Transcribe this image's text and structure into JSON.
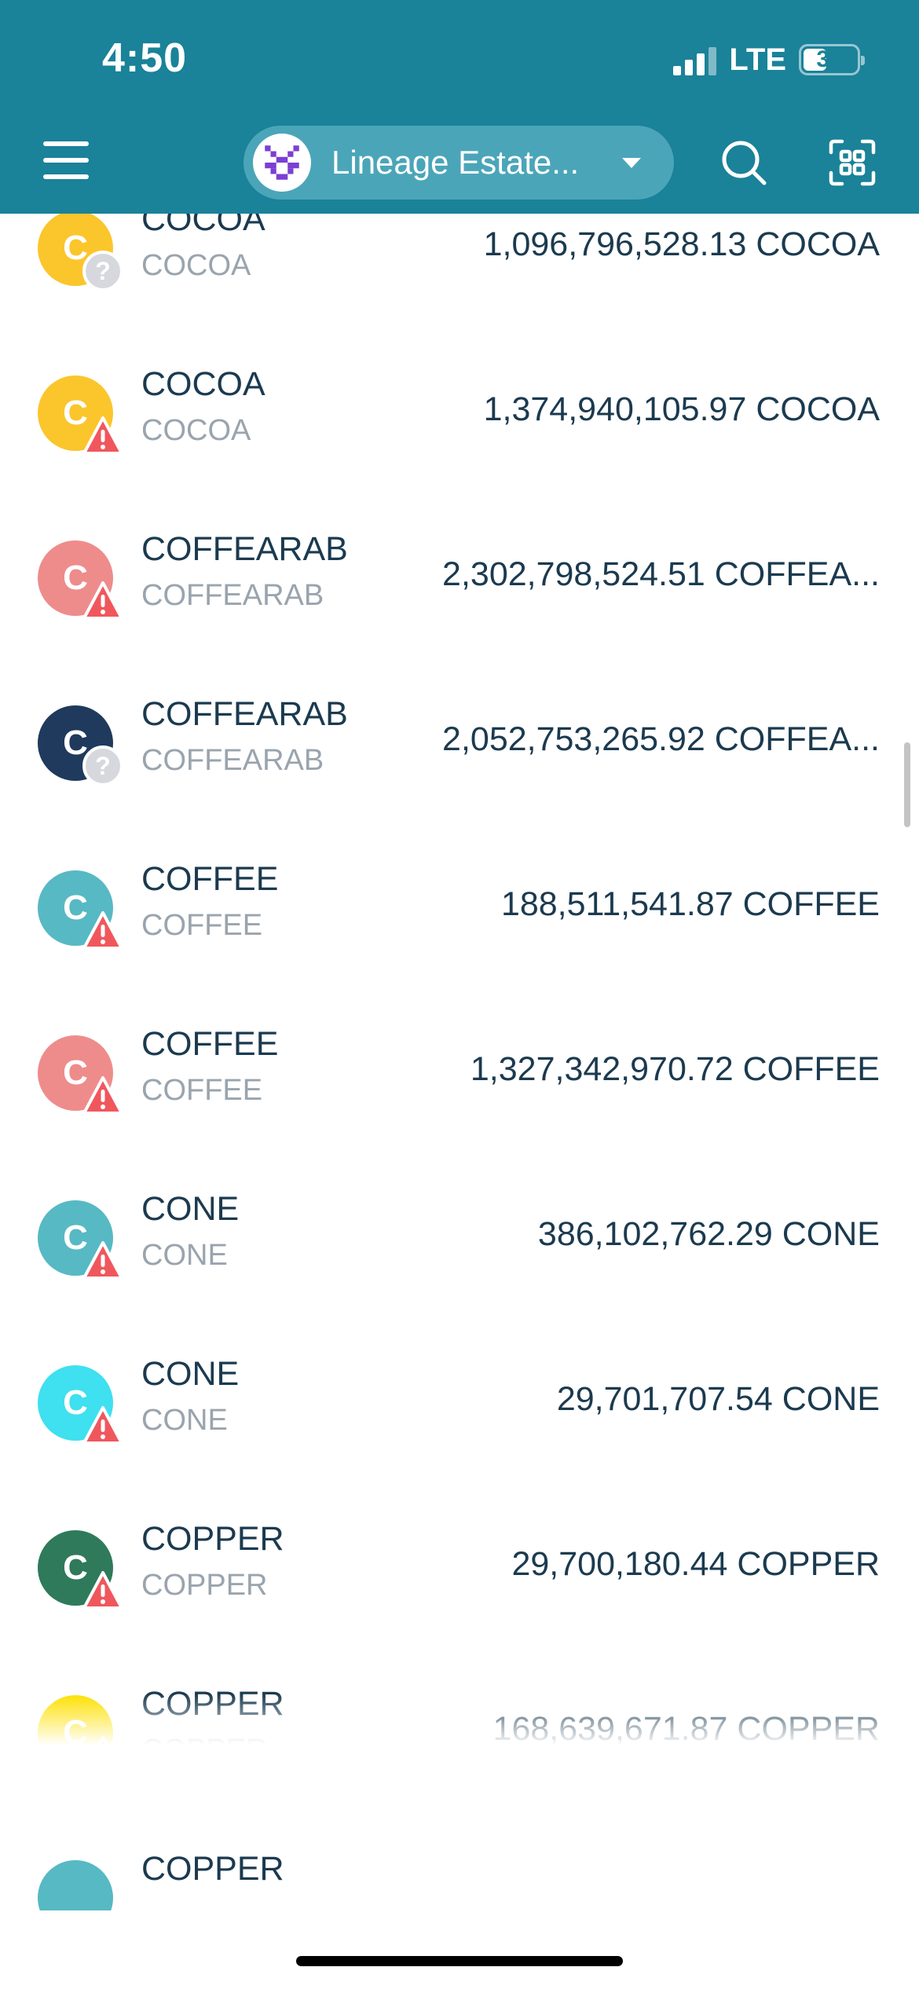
{
  "status_bar": {
    "time": "4:50",
    "network": "LTE",
    "battery": "35"
  },
  "header": {
    "account_name": "Lineage Estate..."
  },
  "tokens": [
    {
      "letter": "C",
      "name": "COCOA",
      "symbol": "COCOA",
      "amount": "1,096,796,528.13 COCOA",
      "color": "#fbc52c",
      "badge": "question"
    },
    {
      "letter": "C",
      "name": "COCOA",
      "symbol": "COCOA",
      "amount": "1,374,940,105.97 COCOA",
      "color": "#fbc52c",
      "badge": "warning"
    },
    {
      "letter": "C",
      "name": "COFFEARAB",
      "symbol": "COFFEARAB",
      "amount": "2,302,798,524.51 COFFEA...",
      "color": "#ee8c8c",
      "badge": "warning"
    },
    {
      "letter": "C",
      "name": "COFFEARAB",
      "symbol": "COFFEARAB",
      "amount": "2,052,753,265.92 COFFEA...",
      "color": "#1f3a5c",
      "badge": "question"
    },
    {
      "letter": "C",
      "name": "COFFEE",
      "symbol": "COFFEE",
      "amount": "188,511,541.87 COFFEE",
      "color": "#57b9c3",
      "badge": "warning"
    },
    {
      "letter": "C",
      "name": "COFFEE",
      "symbol": "COFFEE",
      "amount": "1,327,342,970.72 COFFEE",
      "color": "#ee8c8c",
      "badge": "warning"
    },
    {
      "letter": "C",
      "name": "CONE",
      "symbol": "CONE",
      "amount": "386,102,762.29 CONE",
      "color": "#57b9c3",
      "badge": "warning"
    },
    {
      "letter": "C",
      "name": "CONE",
      "symbol": "CONE",
      "amount": "29,701,707.54 CONE",
      "color": "#3fe0ef",
      "badge": "warning"
    },
    {
      "letter": "C",
      "name": "COPPER",
      "symbol": "COPPER",
      "amount": "29,700,180.44 COPPER",
      "color": "#2e7a5b",
      "badge": "warning"
    },
    {
      "letter": "C",
      "name": "COPPER",
      "symbol": "COPPER",
      "amount": "168,639,671.87 COPPER",
      "color": "#fde000",
      "badge": "warning"
    },
    {
      "letter": "",
      "name": "COPPER",
      "symbol": "",
      "amount": "",
      "color": "#57b9c3",
      "badge": "none"
    }
  ]
}
